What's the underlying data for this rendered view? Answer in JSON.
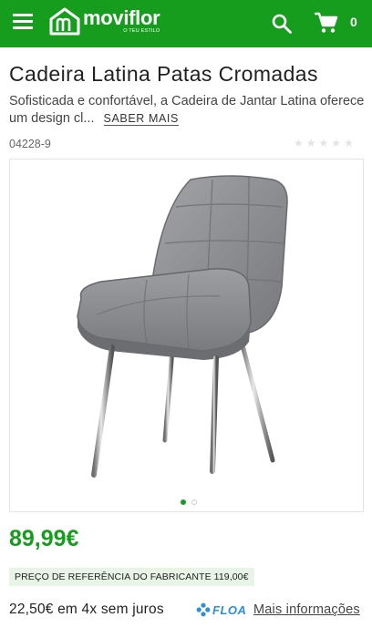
{
  "header": {
    "brand": "moviflor",
    "brand_tagline": "O TEU ESTILO",
    "cart_count": "0",
    "background_color": "#179d1e"
  },
  "product": {
    "title": "Cadeira Latina Patas Cromadas",
    "description": "Sofisticada e confortável, a Cadeira de Jantar Latina oferece um design cl...",
    "more_label": "SABER MAIS",
    "reference": "04228-9",
    "rating_stars": 5,
    "rating_value": 0,
    "image_alt": "Grey upholstered chair with chrome legs",
    "gallery_count": 2,
    "gallery_active": 1,
    "price": "89,99€",
    "manufacturer_price": "PREÇO DE REFERÊNCIA DO FABRICANTE 119,00€",
    "installments": "22,50€ em 4x sem juros",
    "financing_brand": "FLOA",
    "more_info_label": "Mais informações"
  },
  "icons": {
    "menu": "menu-icon",
    "search": "search-icon",
    "cart": "cart-icon",
    "star": "star-icon",
    "floa": "floa-logo-icon"
  },
  "colors": {
    "brand_green": "#179d1e",
    "ref_price_bg": "#e8f4e5",
    "floa_blue": "#2e8fd6"
  }
}
